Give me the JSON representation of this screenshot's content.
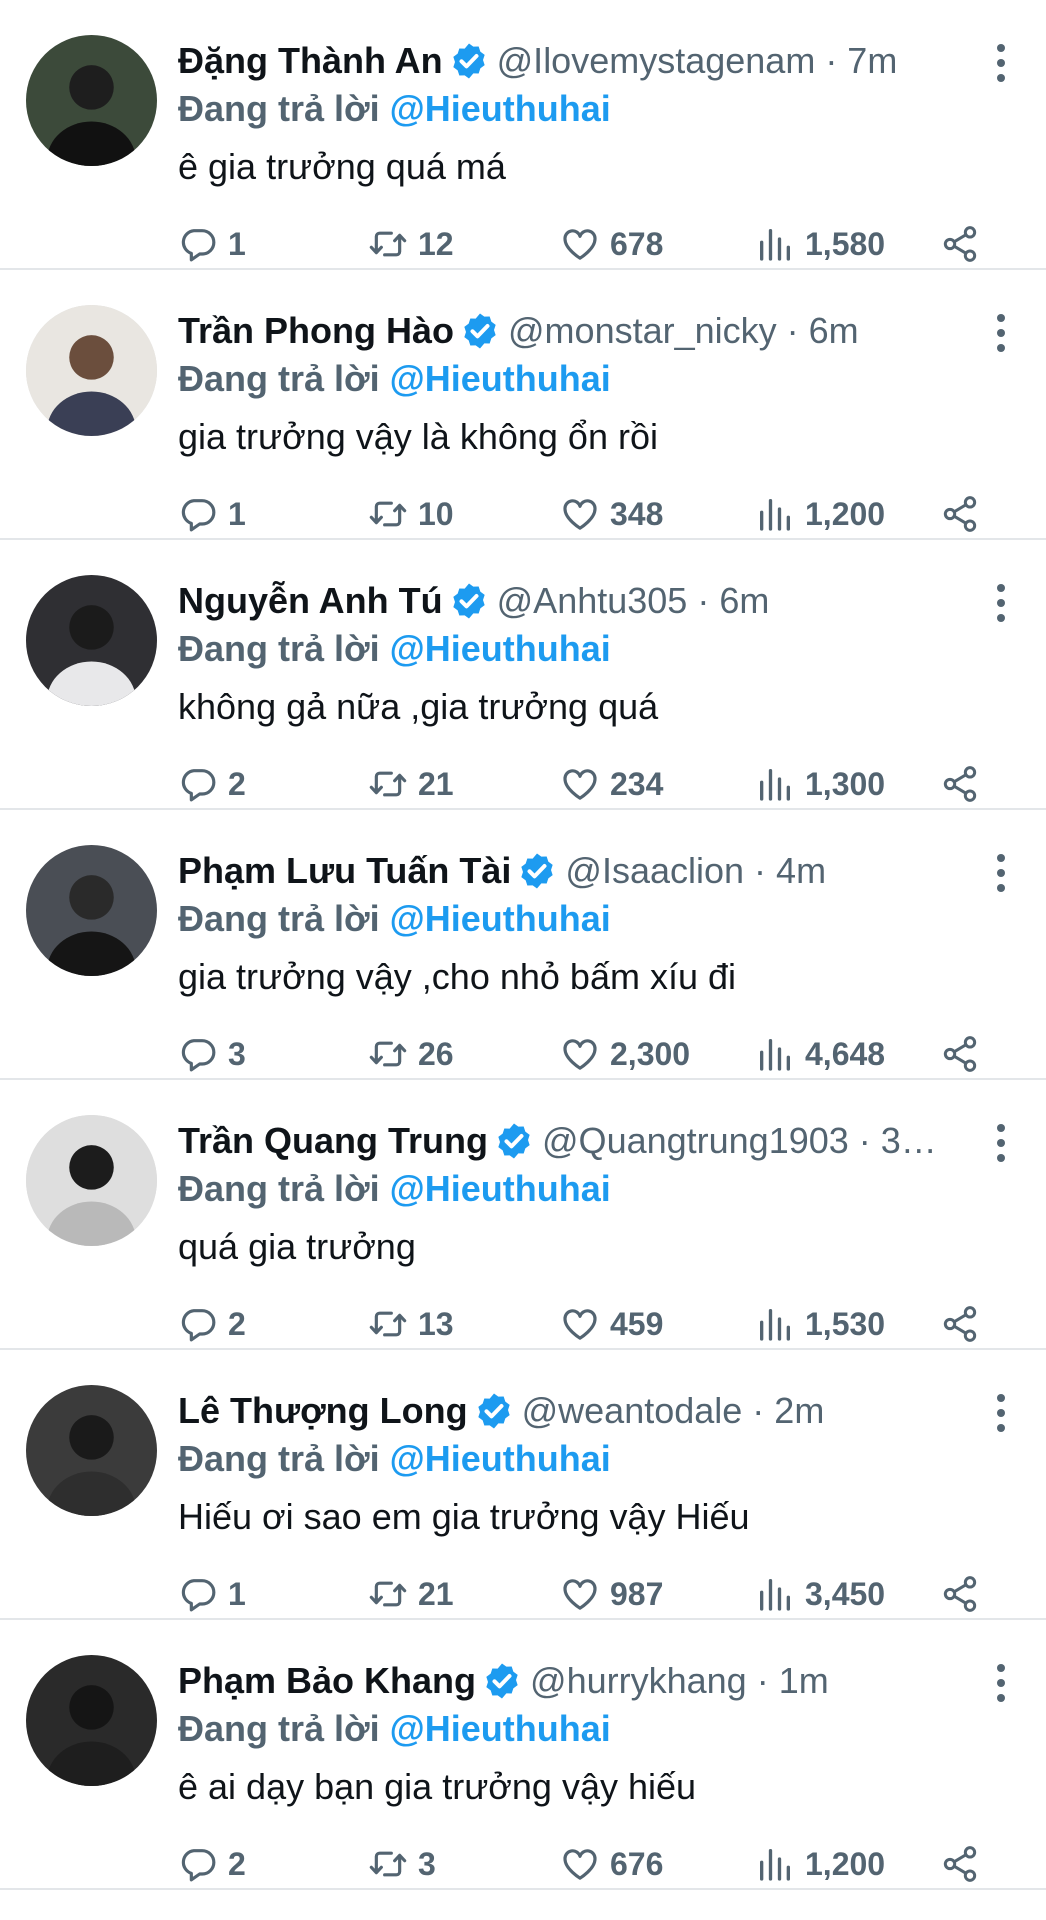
{
  "reply_prefix": "Đang trả lời",
  "icons": {
    "verified": "verified-badge-icon",
    "reply": "reply-icon",
    "retweet": "retweet-icon",
    "like": "heart-icon",
    "views": "views-bar-chart-icon",
    "share": "share-icon",
    "more": "more-dots-icon"
  },
  "colors": {
    "accent": "#1d9bf0",
    "secondary_text": "#536471",
    "primary_text": "#0f1419",
    "divider": "#e3e6e9"
  },
  "tweets": [
    {
      "name": "Đặng Thành An",
      "handle_time": "@Ilovemystagenam · 7m",
      "reply_to": "@Hieuthuhai",
      "text": "ê gia trưởng quá má",
      "replies": "1",
      "retweets": "12",
      "likes": "678",
      "views": "1,580"
    },
    {
      "name": "Trần Phong Hào",
      "handle_time": "@monstar_nicky · 6m",
      "reply_to": "@Hieuthuhai",
      "text": "gia trưởng vậy là không ổn rồi",
      "replies": "1",
      "retweets": "10",
      "likes": "348",
      "views": "1,200"
    },
    {
      "name": "Nguyễn Anh Tú",
      "handle_time": "@Anhtu305 · 6m",
      "reply_to": "@Hieuthuhai",
      "text": "không gả nữa ,gia trưởng quá",
      "replies": "2",
      "retweets": "21",
      "likes": "234",
      "views": "1,300"
    },
    {
      "name": "Phạm Lưu Tuấn Tài",
      "handle_time": "@Isaaclion · 4m",
      "reply_to": "@Hieuthuhai",
      "text": "gia trưởng vậy ,cho nhỏ bấm xíu đi",
      "replies": "3",
      "retweets": "26",
      "likes": "2,300",
      "views": "4,648"
    },
    {
      "name": "Trần Quang Trung",
      "handle_time": "@Quangtrung1903 · 3…",
      "reply_to": "@Hieuthuhai",
      "text": "quá gia trưởng",
      "replies": "2",
      "retweets": "13",
      "likes": "459",
      "views": "1,530"
    },
    {
      "name": "Lê Thượng Long",
      "handle_time": "@weantodale · 2m",
      "reply_to": "@Hieuthuhai",
      "text": "Hiếu ơi sao em gia trưởng vậy Hiếu",
      "replies": "1",
      "retweets": "21",
      "likes": "987",
      "views": "3,450"
    },
    {
      "name": "Phạm Bảo Khang",
      "handle_time": "@hurrykhang · 1m",
      "reply_to": "@Hieuthuhai",
      "text": "ê ai dạy bạn gia trưởng vậy hiếu",
      "replies": "2",
      "retweets": "3",
      "likes": "676",
      "views": "1,200"
    }
  ]
}
